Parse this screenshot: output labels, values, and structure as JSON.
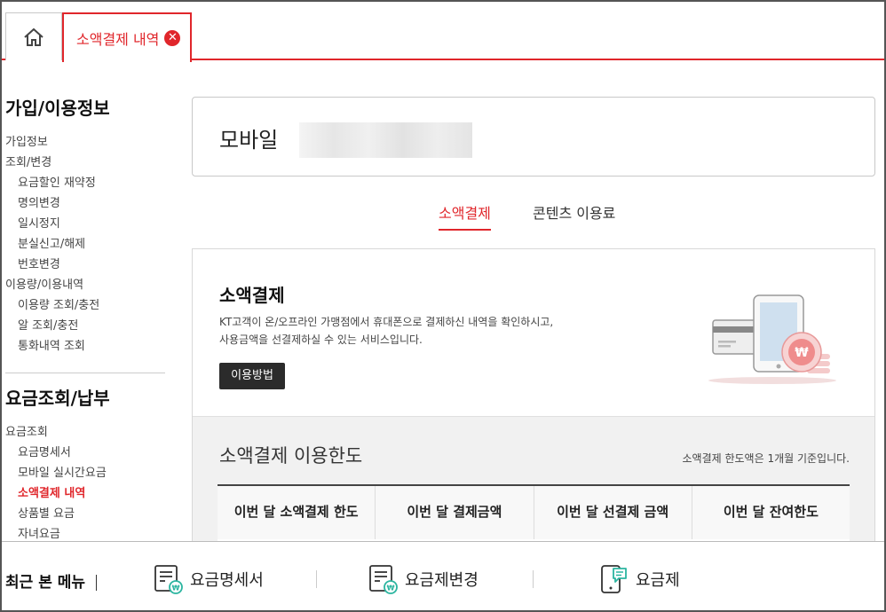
{
  "tabs": {
    "home_icon": "home-icon",
    "active_label": "소액결제 내역",
    "close_icon": "close-icon",
    "close_glyph": "✕"
  },
  "sidebar": {
    "section1": {
      "title": "가입/이용정보",
      "items": [
        {
          "label": "가입정보",
          "level": 1
        },
        {
          "label": "조회/변경",
          "level": 1
        },
        {
          "label": "요금할인 재약정",
          "level": 2
        },
        {
          "label": "명의변경",
          "level": 2
        },
        {
          "label": "일시정지",
          "level": 2
        },
        {
          "label": "분실신고/해제",
          "level": 2
        },
        {
          "label": "번호변경",
          "level": 2
        },
        {
          "label": "이용량/이용내역",
          "level": 1
        },
        {
          "label": "이용량 조회/충전",
          "level": 2
        },
        {
          "label": "알 조회/충전",
          "level": 2
        },
        {
          "label": "통화내역 조회",
          "level": 2
        }
      ]
    },
    "section2": {
      "title": "요금조회/납부",
      "items": [
        {
          "label": "요금조회",
          "level": 1
        },
        {
          "label": "요금명세서",
          "level": 2
        },
        {
          "label": "모바일 실시간요금",
          "level": 2
        },
        {
          "label": "소액결제 내역",
          "level": 2,
          "active": true
        },
        {
          "label": "상품별 요금",
          "level": 2
        },
        {
          "label": "자녀요금",
          "level": 2
        }
      ]
    }
  },
  "mobile": {
    "title": "모바일"
  },
  "subtabs": {
    "payment": "소액결제",
    "contents": "콘텐츠 이용료"
  },
  "service": {
    "title": "소액결제",
    "desc_line1": "KT고객이 온/오프라인 가맹점에서 휴대폰으로 결제하신 내역을 확인하시고,",
    "desc_line2": "사용금액을 선결제하실 수 있는 서비스입니다.",
    "button": "이용방법",
    "won_symbol": "₩"
  },
  "limit": {
    "title": "소액결제 이용한도",
    "note": "소액결제 한도액은 1개월 기준입니다.",
    "headers": [
      "이번 달 소액결제 한도",
      "이번 달 결제금액",
      "이번 달 선결제 금액",
      "이번 달 잔여한도"
    ]
  },
  "recent": {
    "title": "최근 본 메뉴",
    "items": [
      {
        "label": "요금명세서",
        "icon": "bill-icon"
      },
      {
        "label": "요금제변경",
        "icon": "bill-change-icon"
      },
      {
        "label": "요금제",
        "icon": "phone-chat-icon"
      }
    ]
  },
  "colors": {
    "accent": "#e0262b",
    "dark_button": "#2b2b2b",
    "panel_gray": "#f1f1f1",
    "icon_teal": "#2bb5a0"
  }
}
